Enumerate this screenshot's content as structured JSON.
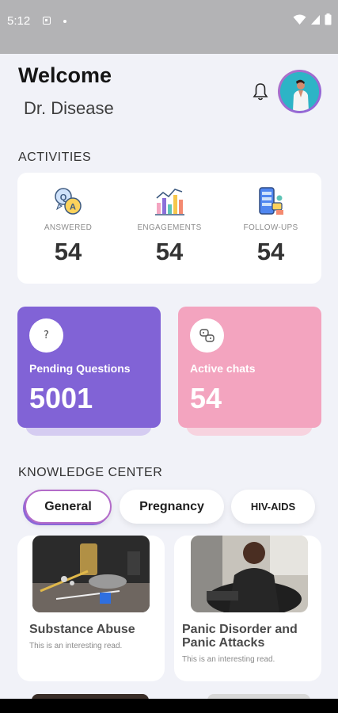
{
  "status_bar": {
    "time": "5:12"
  },
  "header": {
    "welcome": "Welcome",
    "name": "Dr. Disease"
  },
  "activities": {
    "title": "ACTIVITIES",
    "items": [
      {
        "label": "ANSWERED",
        "value": "54",
        "icon": "qa-bubbles-icon"
      },
      {
        "label": "ENGAGEMENTS",
        "value": "54",
        "icon": "bar-chart-icon"
      },
      {
        "label": "FOLLOW-UPS",
        "value": "54",
        "icon": "phone-chat-icon"
      }
    ]
  },
  "stats": {
    "pending": {
      "label": "Pending Questions",
      "value": "5001",
      "icon_text": "?",
      "color": "#8163d6"
    },
    "chats": {
      "label": "Active chats",
      "value": "54",
      "color": "#f3a4bf"
    }
  },
  "knowledge": {
    "title": "KNOWLEDGE CENTER",
    "tabs": [
      "General",
      "Pregnancy",
      "HIV-AIDS"
    ],
    "articles": [
      {
        "title": "Substance Abuse",
        "subtitle": "This is an interesting read."
      },
      {
        "title": "Panic Disorder and Panic Attacks",
        "subtitle": "This is an interesting read."
      }
    ]
  }
}
